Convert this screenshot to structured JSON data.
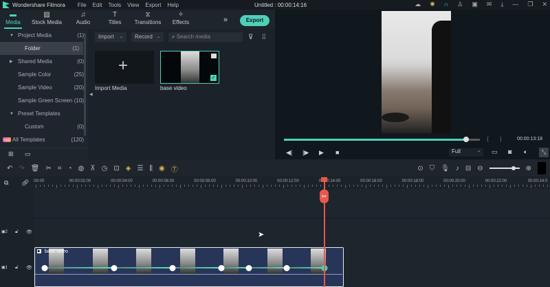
{
  "app": {
    "name": "Wondershare Filmora",
    "title": "Untitled : 00:00:14:16",
    "menu": [
      "File",
      "Edit",
      "Tools",
      "View",
      "Export",
      "Help"
    ]
  },
  "window_icons": [
    "cloud-icon",
    "bulb-icon",
    "headset-icon",
    "user-icon",
    "save-icon",
    "mail-icon",
    "download-icon",
    "minimize-icon",
    "restore-icon",
    "close-icon"
  ],
  "nav": {
    "tabs": [
      {
        "label": "Media",
        "icon": "folder"
      },
      {
        "label": "Stock Media",
        "icon": "image"
      },
      {
        "label": "Audio",
        "icon": "music"
      },
      {
        "label": "Titles",
        "icon": "T"
      },
      {
        "label": "Transitions",
        "icon": "transition"
      },
      {
        "label": "Effects",
        "icon": "sparkle"
      }
    ],
    "export_label": "Export"
  },
  "sidebar": {
    "items": [
      {
        "label": "Project Media",
        "count": "(1)",
        "arrow": "▼"
      },
      {
        "label": "Folder",
        "count": "(1)"
      },
      {
        "label": "Shared Media",
        "count": "(0)",
        "arrow": "▶"
      },
      {
        "label": "Sample Color",
        "count": "(25)"
      },
      {
        "label": "Sample Video",
        "count": "(20)"
      },
      {
        "label": "Sample Green Screen",
        "count": "(10)"
      },
      {
        "label": "Preset Templates",
        "count": "",
        "arrow": "▼"
      },
      {
        "label": "Custom",
        "count": "(0)"
      },
      {
        "label": "All Templates",
        "count": "(120)",
        "badge": "New"
      }
    ]
  },
  "media": {
    "import_label": "Import",
    "record_label": "Record",
    "search_placeholder": "Search media",
    "items": [
      {
        "label": "Import Media"
      },
      {
        "label": "base video"
      }
    ]
  },
  "player": {
    "time": "00:00:13:18",
    "progress": 0.93,
    "quality": "Full"
  },
  "ruler": {
    "labels": [
      ":00:00",
      "00:00:02:00",
      "00:00:04:00",
      "00:00:06:00",
      "00:00:08:00",
      "00:00:10:00",
      "00:00:12:00",
      "00:00:14:00",
      "00:00:16:00",
      "00:00:18:00",
      "00:00:20:00",
      "00:00:22:00",
      "00:00:24:0"
    ]
  },
  "tracks": {
    "track2": "2",
    "track1": "1",
    "clip_label": "base video"
  },
  "accent": "#4fd1b5",
  "playhead_color": "#e8584a"
}
